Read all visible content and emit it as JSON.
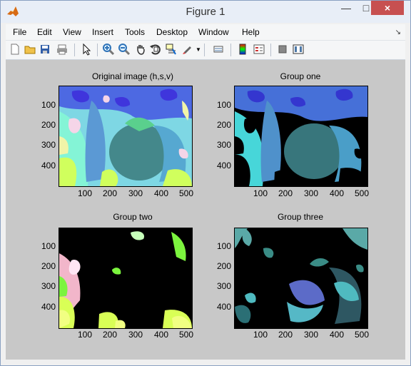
{
  "window": {
    "title": "Figure 1"
  },
  "menu": {
    "items": [
      "File",
      "Edit",
      "View",
      "Insert",
      "Tools",
      "Desktop",
      "Window",
      "Help"
    ]
  },
  "toolbar": {
    "icons": [
      "new-file-icon",
      "open-folder-icon",
      "save-icon",
      "print-icon",
      "pointer-icon",
      "zoom-in-icon",
      "zoom-out-icon",
      "pan-icon",
      "rotate-icon",
      "data-cursor-icon",
      "brush-icon",
      "link-icon",
      "colorbar-icon",
      "legend-icon",
      "hide-plot-tools-icon",
      "show-plot-tools-icon"
    ]
  },
  "plots": [
    {
      "title": "Original image (h,s,v)",
      "y_ticks": [
        "100",
        "200",
        "300",
        "400"
      ],
      "x_ticks": [
        "100",
        "200",
        "300",
        "400",
        "500"
      ]
    },
    {
      "title": "Group one",
      "y_ticks": [
        "100",
        "200",
        "300",
        "400"
      ],
      "x_ticks": [
        "100",
        "200",
        "300",
        "400",
        "500"
      ]
    },
    {
      "title": "Group two",
      "y_ticks": [
        "100",
        "200",
        "300",
        "400"
      ],
      "x_ticks": [
        "100",
        "200",
        "300",
        "400",
        "500"
      ]
    },
    {
      "title": "Group three",
      "y_ticks": [
        "100",
        "200",
        "300",
        "400"
      ],
      "x_ticks": [
        "100",
        "200",
        "300",
        "400",
        "500"
      ]
    }
  ],
  "colors": {
    "figure_background": "#c8c8c8",
    "title_bar": "#e8eef7",
    "close_button": "#c75050"
  }
}
